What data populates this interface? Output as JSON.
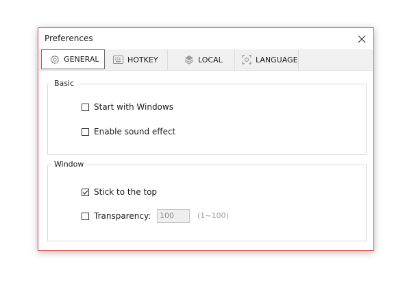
{
  "window": {
    "title": "Preferences"
  },
  "tabs": [
    {
      "label": "GENERAL",
      "icon": "gear-icon",
      "active": true
    },
    {
      "label": "HOTKEY",
      "icon": "keyboard-icon",
      "active": false
    },
    {
      "label": "LOCAL",
      "icon": "layers-icon",
      "active": false
    },
    {
      "label": "LANGUAGE",
      "icon": "scan-icon",
      "active": false
    }
  ],
  "basic": {
    "title": "Basic",
    "start_with_windows": {
      "label": "Start with Windows",
      "checked": false
    },
    "sound_effect": {
      "label": "Enable sound effect",
      "checked": false
    }
  },
  "window_group": {
    "title": "Window",
    "stick_top": {
      "label": "Stick to the top",
      "checked": true
    },
    "transparency": {
      "label": "Transparency:",
      "checked": false,
      "value": "100",
      "range": "(1~100)"
    }
  },
  "colors": {
    "border": "#d64545",
    "tabbar": "#f0f0f0",
    "group_border": "#dcdcdc"
  }
}
